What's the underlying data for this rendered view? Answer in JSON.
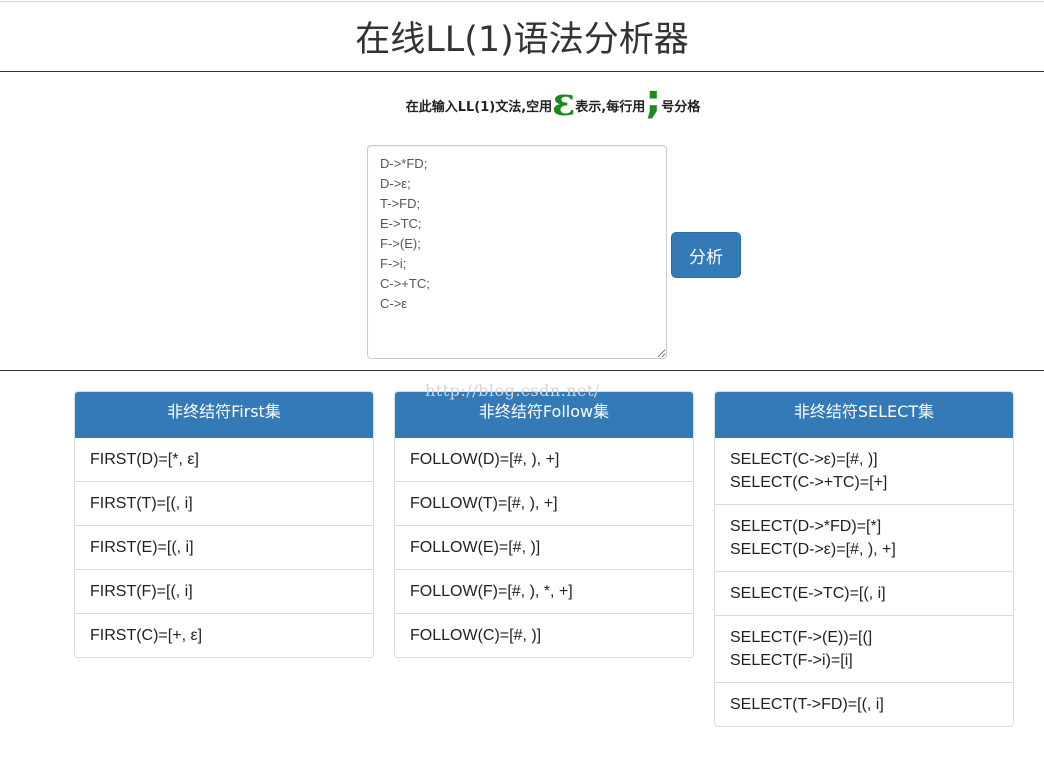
{
  "header": {
    "title": "在线LL(1)语法分析器"
  },
  "instruction": {
    "prefix": "在此输入LL(1)文法,空用",
    "epsilon_glyph": "ε",
    "middle": "表示,每行用",
    "semicolon_glyph": ";",
    "suffix": "号分格"
  },
  "grammar_input": {
    "value": "D->*FD;\nD->ε;\nT->FD;\nE->TC;\nF->(E);\nF->i;\nC->+TC;\nC->ε"
  },
  "analyze_button": {
    "label": "分析"
  },
  "watermark": {
    "text": "http://blog.csdn.net/"
  },
  "panels": {
    "first": {
      "title": "非终结符First集",
      "items": [
        "FIRST(D)=[*, ε]",
        "FIRST(T)=[(, i]",
        "FIRST(E)=[(, i]",
        "FIRST(F)=[(, i]",
        "FIRST(C)=[+, ε]"
      ]
    },
    "follow": {
      "title": "非终结符Follow集",
      "items": [
        "FOLLOW(D)=[#, ), +]",
        "FOLLOW(T)=[#, ), +]",
        "FOLLOW(E)=[#, )]",
        "FOLLOW(F)=[#, ), *, +]",
        "FOLLOW(C)=[#, )]"
      ]
    },
    "select": {
      "title": "非终结符SELECT集",
      "items": [
        [
          "SELECT(C->ε)=[#, )]",
          "SELECT(C->+TC)=[+]"
        ],
        [
          "SELECT(D->*FD)=[*]",
          "SELECT(D->ε)=[#, ), +]"
        ],
        [
          "SELECT(E->TC)=[(, i]"
        ],
        [
          "SELECT(F->(E))=[(]",
          "SELECT(F->i)=[i]"
        ],
        [
          "SELECT(T->FD)=[(, i]"
        ]
      ]
    }
  },
  "colors": {
    "primary": "#337ab7",
    "accent_green": "#1a8a1a"
  }
}
